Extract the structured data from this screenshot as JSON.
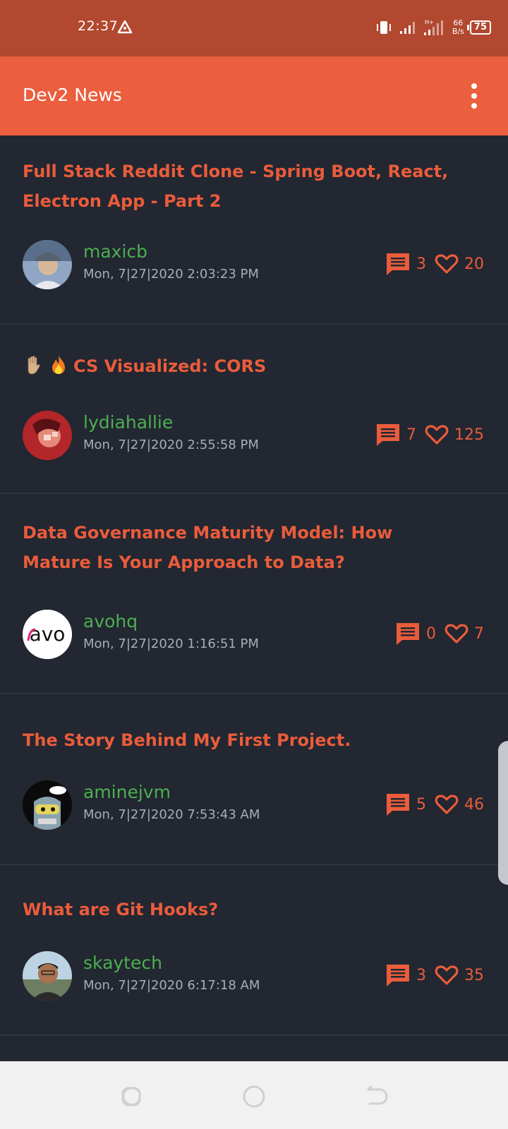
{
  "status_bar": {
    "time": "22:37",
    "net_speed_value": "66",
    "net_speed_unit": "B/s",
    "battery": "75",
    "signal_label": "H+"
  },
  "app": {
    "title": "Dev2 News",
    "accent_color": "#eb5e3e",
    "background_color": "#222731",
    "author_color": "#4caf50"
  },
  "posts": [
    {
      "title": "Full Stack Reddit Clone - Spring Boot, React, Electron App - Part 2",
      "author": "maxicb",
      "date": "Mon, 7|27|2020 2:03:23 PM",
      "comments": "3",
      "likes": "20"
    },
    {
      "title": "CS Visualized: CORS",
      "emoji": [
        "raised-hand",
        "fire"
      ],
      "author": "lydiahallie",
      "date": "Mon, 7|27|2020 2:55:58 PM",
      "comments": "7",
      "likes": "125"
    },
    {
      "title": "Data Governance Maturity Model: How Mature Is Your Approach to Data?",
      "author": "avohq",
      "avatar_text": "avo",
      "date": "Mon, 7|27|2020 1:16:51 PM",
      "comments": "0",
      "likes": "7"
    },
    {
      "title": "The Story Behind My First Project.",
      "author": "aminejvm",
      "date": "Mon, 7|27|2020 7:53:43 AM",
      "comments": "5",
      "likes": "46"
    },
    {
      "title": "What are Git Hooks?",
      "author": "skaytech",
      "date": "Mon, 7|27|2020 6:17:18 AM",
      "comments": "3",
      "likes": "35"
    }
  ],
  "nav": {
    "recents": "recents-icon",
    "home": "home-icon",
    "back": "back-icon"
  }
}
